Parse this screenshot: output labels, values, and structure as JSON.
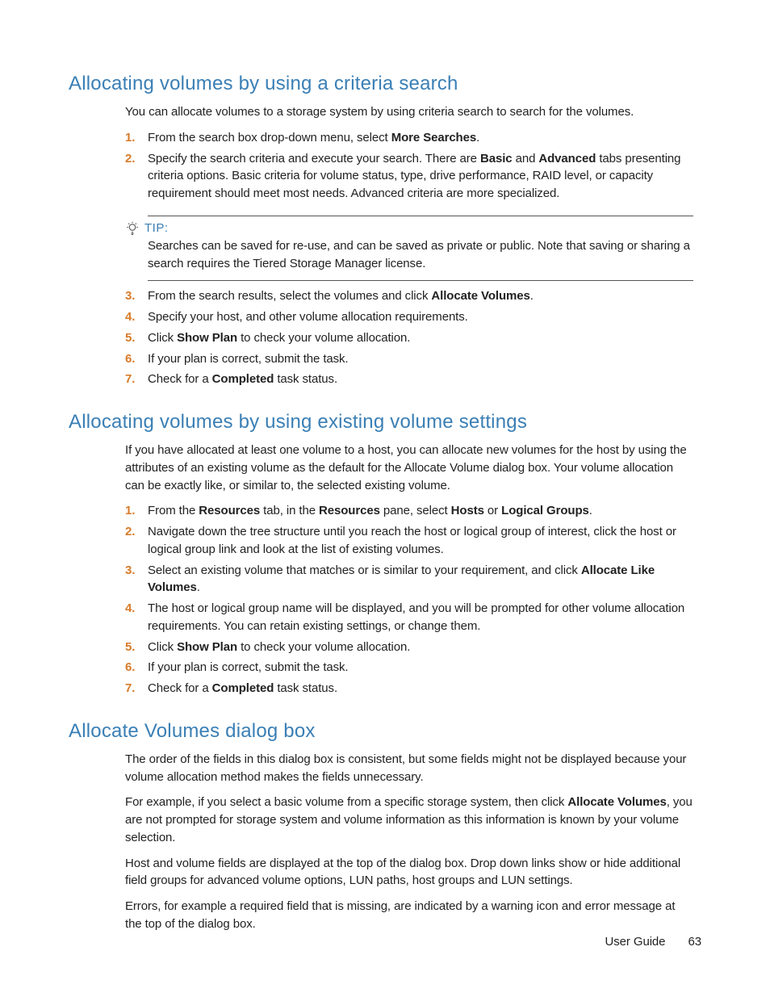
{
  "section1": {
    "heading": "Allocating volumes by using a criteria search",
    "intro": "You can allocate volumes to a storage system by using criteria search to search for the volumes.",
    "steps": [
      {
        "n": "1.",
        "pre": "From the search box drop-down menu, select ",
        "b1": "More Searches",
        "post": "."
      },
      {
        "n": "2.",
        "pre": "Specify the search criteria and execute your search. There are ",
        "b1": "Basic",
        "mid": " and ",
        "b2": "Advanced",
        "post": " tabs presenting criteria options. Basic criteria for volume status, type, drive performance, RAID level, or capacity requirement should meet most needs. Advanced criteria are more specialized."
      }
    ],
    "tip_label": "TIP:",
    "tip_body": "Searches can be saved for re-use, and can be saved as private or public. Note that saving or sharing a search requires the Tiered Storage Manager license.",
    "steps2": [
      {
        "n": "3.",
        "pre": "From the search results, select the volumes and click ",
        "b1": "Allocate Volumes",
        "post": "."
      },
      {
        "n": "4.",
        "pre": "Specify your host, and other volume allocation requirements."
      },
      {
        "n": "5.",
        "pre": "Click ",
        "b1": "Show Plan",
        "post": " to check your volume allocation."
      },
      {
        "n": "6.",
        "pre": "If your plan is correct, submit the task."
      },
      {
        "n": "7.",
        "pre": "Check for a ",
        "b1": "Completed",
        "post": " task status."
      }
    ]
  },
  "section2": {
    "heading": "Allocating volumes by using existing volume settings",
    "intro": "If you have allocated at least one volume to a host, you can allocate new volumes for the host by using the attributes of an existing volume as the default for the Allocate Volume dialog box. Your volume allocation can be exactly like, or similar to, the selected existing volume.",
    "steps": [
      {
        "n": "1.",
        "pre": "From the ",
        "b1": "Resources",
        "mid": " tab, in the ",
        "b2": "Resources",
        "mid2": " pane, select ",
        "b3": "Hosts",
        "mid3": " or ",
        "b4": "Logical Groups",
        "post": "."
      },
      {
        "n": "2.",
        "pre": "Navigate down the tree structure until you reach the host or logical group of interest, click the host or logical group link and look at the list of existing volumes."
      },
      {
        "n": "3.",
        "pre": "Select an existing volume that matches or is similar to your requirement, and click ",
        "b1": "Allocate Like Volumes",
        "post": "."
      },
      {
        "n": "4.",
        "pre": "The host or logical group name will be displayed, and you will be prompted for other volume allocation requirements. You can retain existing settings, or change them."
      },
      {
        "n": "5.",
        "pre": "Click ",
        "b1": "Show Plan",
        "post": " to check your volume allocation."
      },
      {
        "n": "6.",
        "pre": "If your plan is correct, submit the task."
      },
      {
        "n": "7.",
        "pre": "Check for a ",
        "b1": "Completed",
        "post": " task status."
      }
    ]
  },
  "section3": {
    "heading": "Allocate Volumes dialog box",
    "p1": "The order of the fields in this dialog box is consistent, but some fields might not be displayed because your volume allocation method makes the fields unnecessary.",
    "p2_pre": "For example, if you select a basic volume from a specific storage system, then click ",
    "p2_b": "Allocate Volumes",
    "p2_post": ", you are not prompted for storage system and volume information as this information is known by your volume selection.",
    "p3": "Host and volume fields are displayed at the top of the dialog box. Drop down links show or hide additional field groups for advanced volume options, LUN paths, host groups and LUN settings.",
    "p4": "Errors, for example a required field that is missing, are indicated by a warning icon and error message at the top of the dialog box."
  },
  "footer": {
    "label": "User Guide",
    "page": "63"
  }
}
